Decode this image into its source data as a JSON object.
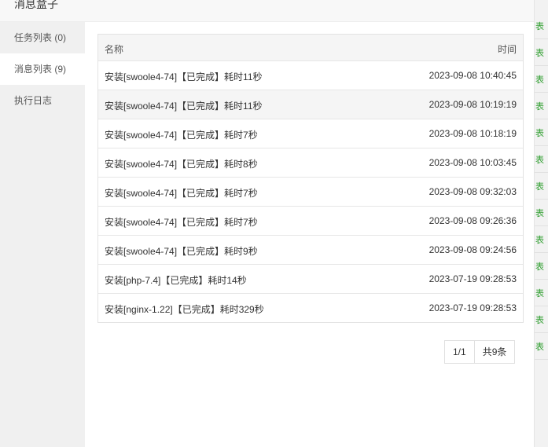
{
  "dialog": {
    "title": "消息盒子"
  },
  "sidebar": {
    "items": [
      {
        "label": "任务列表 (0)"
      },
      {
        "label": "消息列表 (9)"
      },
      {
        "label": "执行日志"
      }
    ],
    "active_index": 1
  },
  "table": {
    "headers": {
      "name": "名称",
      "time": "时间"
    },
    "rows": [
      {
        "name": "安装[swoole4-74]【已完成】耗时11秒",
        "time": "2023-09-08 10:40:45"
      },
      {
        "name": "安装[swoole4-74]【已完成】耗时11秒",
        "time": "2023-09-08 10:19:19"
      },
      {
        "name": "安装[swoole4-74]【已完成】耗时7秒",
        "time": "2023-09-08 10:18:19"
      },
      {
        "name": "安装[swoole4-74]【已完成】耗时8秒",
        "time": "2023-09-08 10:03:45"
      },
      {
        "name": "安装[swoole4-74]【已完成】耗时7秒",
        "time": "2023-09-08 09:32:03"
      },
      {
        "name": "安装[swoole4-74]【已完成】耗时7秒",
        "time": "2023-09-08 09:26:36"
      },
      {
        "name": "安装[swoole4-74]【已完成】耗时9秒",
        "time": "2023-09-08 09:24:56"
      },
      {
        "name": "安装[php-7.4]【已完成】耗时14秒",
        "time": "2023-07-19 09:28:53"
      },
      {
        "name": "安装[nginx-1.22]【已完成】耗时329秒",
        "time": "2023-07-19 09:28:53"
      }
    ]
  },
  "pager": {
    "page": "1/1",
    "total": "共9条"
  },
  "background_strip": {
    "marks": [
      "表",
      "表",
      "表",
      "表",
      "表",
      "表",
      "表",
      "表",
      "表",
      "表",
      "表",
      "表",
      "表"
    ]
  },
  "colors": {
    "accent_green": "#2e9e2e",
    "sidebar_bg": "#f0f0f0",
    "row_alt": "#f5f5f5"
  }
}
